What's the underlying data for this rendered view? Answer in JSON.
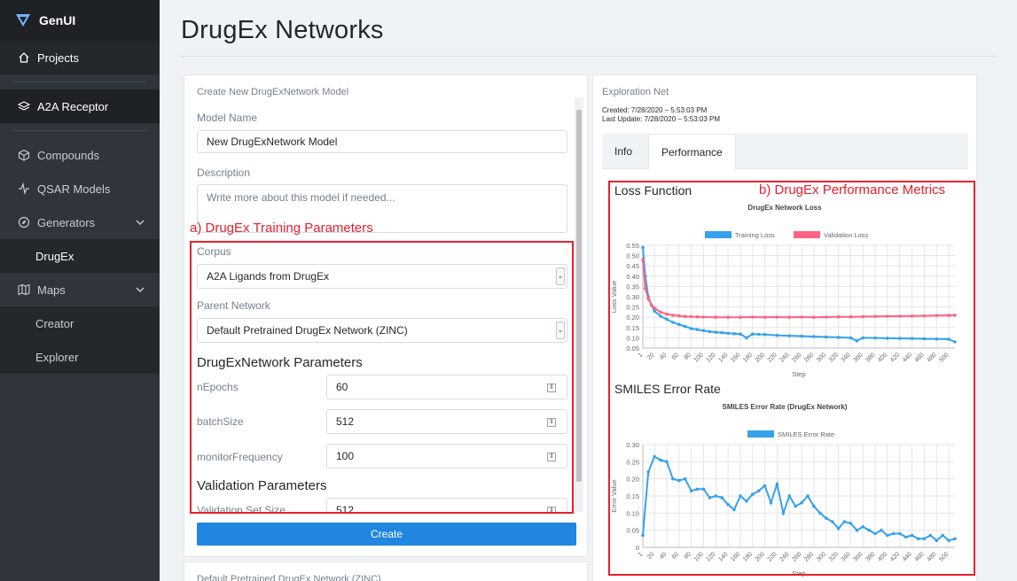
{
  "brand": {
    "name": "GenUI"
  },
  "sidebar": {
    "projects": "Projects",
    "project_name": "A2A Receptor",
    "items": [
      {
        "label": "Compounds"
      },
      {
        "label": "QSAR Models"
      },
      {
        "label": "Generators"
      },
      {
        "label": "DrugEx"
      },
      {
        "label": "Maps"
      },
      {
        "label": "Creator"
      },
      {
        "label": "Explorer"
      }
    ]
  },
  "page": {
    "title": "DrugEx Networks"
  },
  "create_form": {
    "header": "Create New DrugExNetwork Model",
    "model_name_label": "Model Name",
    "model_name_value": "New DrugExNetwork Model",
    "description_label": "Description",
    "description_placeholder": "Write more about this model if needed...",
    "corpus_label": "Corpus",
    "corpus_value": "A2A Ligands from DrugEx",
    "parent_label": "Parent Network",
    "parent_value": "Default Pretrained DrugEx Network (ZINC)",
    "params_title": "DrugExNetwork Parameters",
    "params": [
      {
        "label": "nEpochs",
        "value": "60"
      },
      {
        "label": "batchSize",
        "value": "512"
      },
      {
        "label": "monitorFrequency",
        "value": "100"
      }
    ],
    "validation_title": "Validation Parameters",
    "validation_param": {
      "label": "Validation Set Size",
      "value": "512"
    },
    "create_button": "Create",
    "next_card_header": "Default Pretrained DrugEx Network (ZINC)"
  },
  "annotations": {
    "training_params": "a) DrugEx Training Parameters",
    "performance_metrics": "b) DrugEx Performance Metrics"
  },
  "exploration": {
    "header": "Exploration Net",
    "created": "Created: 7/28/2020 – 5:53:03 PM",
    "updated": "Last Update: 7/28/2020 – 5:53:03 PM",
    "tabs": [
      {
        "label": "Info"
      },
      {
        "label": "Performance"
      }
    ],
    "loss_section": "Loss Function",
    "error_section": "SMILES Error Rate"
  },
  "colors": {
    "accent": "#2086e0",
    "training": "#36a2eb",
    "validation": "#ff6384",
    "annotation": "#e8202d",
    "sidebar": "#2f353a"
  },
  "chart_data": [
    {
      "type": "line",
      "title": "DrugEx Network Loss",
      "xlabel": "Step",
      "ylabel": "Loss Value",
      "ylim": [
        0.05,
        0.55
      ],
      "yticks": [
        "0.55",
        "0.50",
        "0.45",
        "0.40",
        "0.35",
        "0.30",
        "0.25",
        "0.20",
        "0.15",
        "0.10",
        "0.05"
      ],
      "xticks": [
        "1",
        "20",
        "40",
        "60",
        "80",
        "100",
        "120",
        "140",
        "160",
        "180",
        "200",
        "220",
        "240",
        "260",
        "280",
        "300",
        "320",
        "340",
        "360",
        "380",
        "400",
        "420",
        "440",
        "460",
        "480",
        "500"
      ],
      "series": [
        {
          "name": "Training Loss",
          "x": [
            1,
            5,
            10,
            15,
            20,
            30,
            40,
            50,
            60,
            70,
            80,
            90,
            100,
            110,
            120,
            130,
            140,
            150,
            160,
            170,
            180,
            190,
            200,
            220,
            240,
            260,
            280,
            300,
            320,
            340,
            350,
            360,
            380,
            400,
            420,
            440,
            460,
            480,
            500,
            510
          ],
          "values": [
            0.54,
            0.4,
            0.3,
            0.26,
            0.23,
            0.205,
            0.19,
            0.175,
            0.165,
            0.155,
            0.145,
            0.14,
            0.135,
            0.13,
            0.127,
            0.125,
            0.122,
            0.12,
            0.118,
            0.1,
            0.118,
            0.117,
            0.116,
            0.112,
            0.11,
            0.108,
            0.106,
            0.104,
            0.102,
            0.1,
            0.085,
            0.1,
            0.099,
            0.098,
            0.097,
            0.096,
            0.095,
            0.094,
            0.093,
            0.08
          ]
        },
        {
          "name": "Validation Loss",
          "x": [
            1,
            5,
            10,
            15,
            20,
            30,
            40,
            50,
            60,
            70,
            80,
            90,
            100,
            120,
            140,
            160,
            180,
            200,
            220,
            240,
            260,
            280,
            300,
            320,
            340,
            360,
            380,
            400,
            420,
            440,
            460,
            480,
            500,
            510
          ],
          "values": [
            0.48,
            0.34,
            0.29,
            0.26,
            0.245,
            0.225,
            0.215,
            0.21,
            0.207,
            0.204,
            0.203,
            0.202,
            0.201,
            0.2,
            0.2,
            0.2,
            0.201,
            0.2,
            0.201,
            0.2,
            0.201,
            0.2,
            0.201,
            0.202,
            0.202,
            0.203,
            0.204,
            0.205,
            0.205,
            0.206,
            0.207,
            0.208,
            0.209,
            0.21
          ]
        }
      ]
    },
    {
      "type": "line",
      "title": "SMILES Error Rate (DrugEx Network)",
      "xlabel": "Step",
      "ylabel": "Error Value",
      "ylim": [
        0,
        0.3
      ],
      "yticks": [
        "0.30",
        "0.25",
        "0.20",
        "0.15",
        "0.10",
        "0.05",
        "0"
      ],
      "xticks": [
        "1",
        "20",
        "40",
        "60",
        "80",
        "100",
        "120",
        "140",
        "160",
        "180",
        "200",
        "220",
        "240",
        "260",
        "280",
        "300",
        "320",
        "340",
        "360",
        "380",
        "400",
        "420",
        "440",
        "460",
        "480",
        "500"
      ],
      "series": [
        {
          "name": "SMILES Error Rate",
          "x": [
            1,
            10,
            20,
            30,
            40,
            50,
            60,
            70,
            80,
            90,
            100,
            110,
            120,
            130,
            140,
            150,
            160,
            170,
            180,
            190,
            200,
            210,
            220,
            230,
            240,
            250,
            260,
            270,
            280,
            290,
            300,
            310,
            320,
            330,
            340,
            350,
            360,
            370,
            380,
            390,
            400,
            410,
            420,
            430,
            440,
            450,
            460,
            470,
            480,
            490,
            500,
            510
          ],
          "values": [
            0.035,
            0.22,
            0.265,
            0.255,
            0.25,
            0.2,
            0.195,
            0.2,
            0.165,
            0.17,
            0.17,
            0.145,
            0.15,
            0.145,
            0.125,
            0.11,
            0.15,
            0.135,
            0.155,
            0.165,
            0.18,
            0.13,
            0.185,
            0.1,
            0.15,
            0.12,
            0.13,
            0.15,
            0.12,
            0.1,
            0.085,
            0.075,
            0.055,
            0.075,
            0.07,
            0.05,
            0.06,
            0.05,
            0.04,
            0.05,
            0.035,
            0.04,
            0.04,
            0.03,
            0.035,
            0.025,
            0.025,
            0.035,
            0.02,
            0.035,
            0.02,
            0.025
          ]
        }
      ]
    }
  ]
}
